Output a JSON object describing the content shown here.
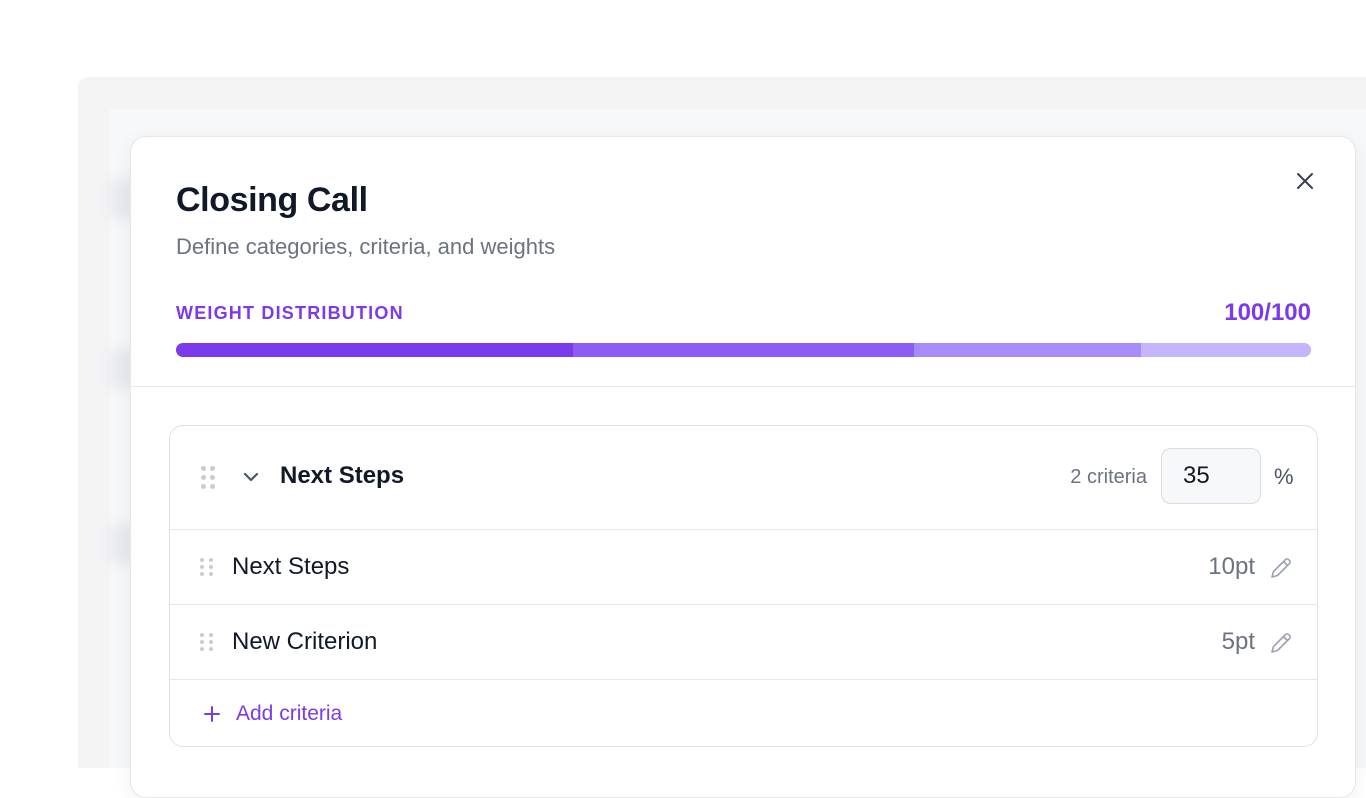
{
  "modal": {
    "title": "Closing Call",
    "subtitle": "Define categories, criteria, and weights",
    "close_icon": "close-icon"
  },
  "weight_distribution": {
    "label": "WEIGHT DISTRIBUTION",
    "value_text": "100/100",
    "segments": [
      {
        "percent": 35,
        "color": "#7c3aed"
      },
      {
        "percent": 30,
        "color": "#8b5cf6"
      },
      {
        "percent": 20,
        "color": "#a78bfa"
      },
      {
        "percent": 15,
        "color": "#c4b5fd"
      }
    ]
  },
  "category": {
    "name": "Next Steps",
    "criteria_count": "2 criteria",
    "weight_value": "35",
    "weight_unit": "%",
    "criteria": [
      {
        "name": "Next Steps",
        "points": "10pt"
      },
      {
        "name": "New Criterion",
        "points": "5pt"
      }
    ],
    "add_label": "Add criteria"
  },
  "colors": {
    "accent": "#7c3aed",
    "text_primary": "#111827",
    "text_muted": "#6b7280"
  }
}
